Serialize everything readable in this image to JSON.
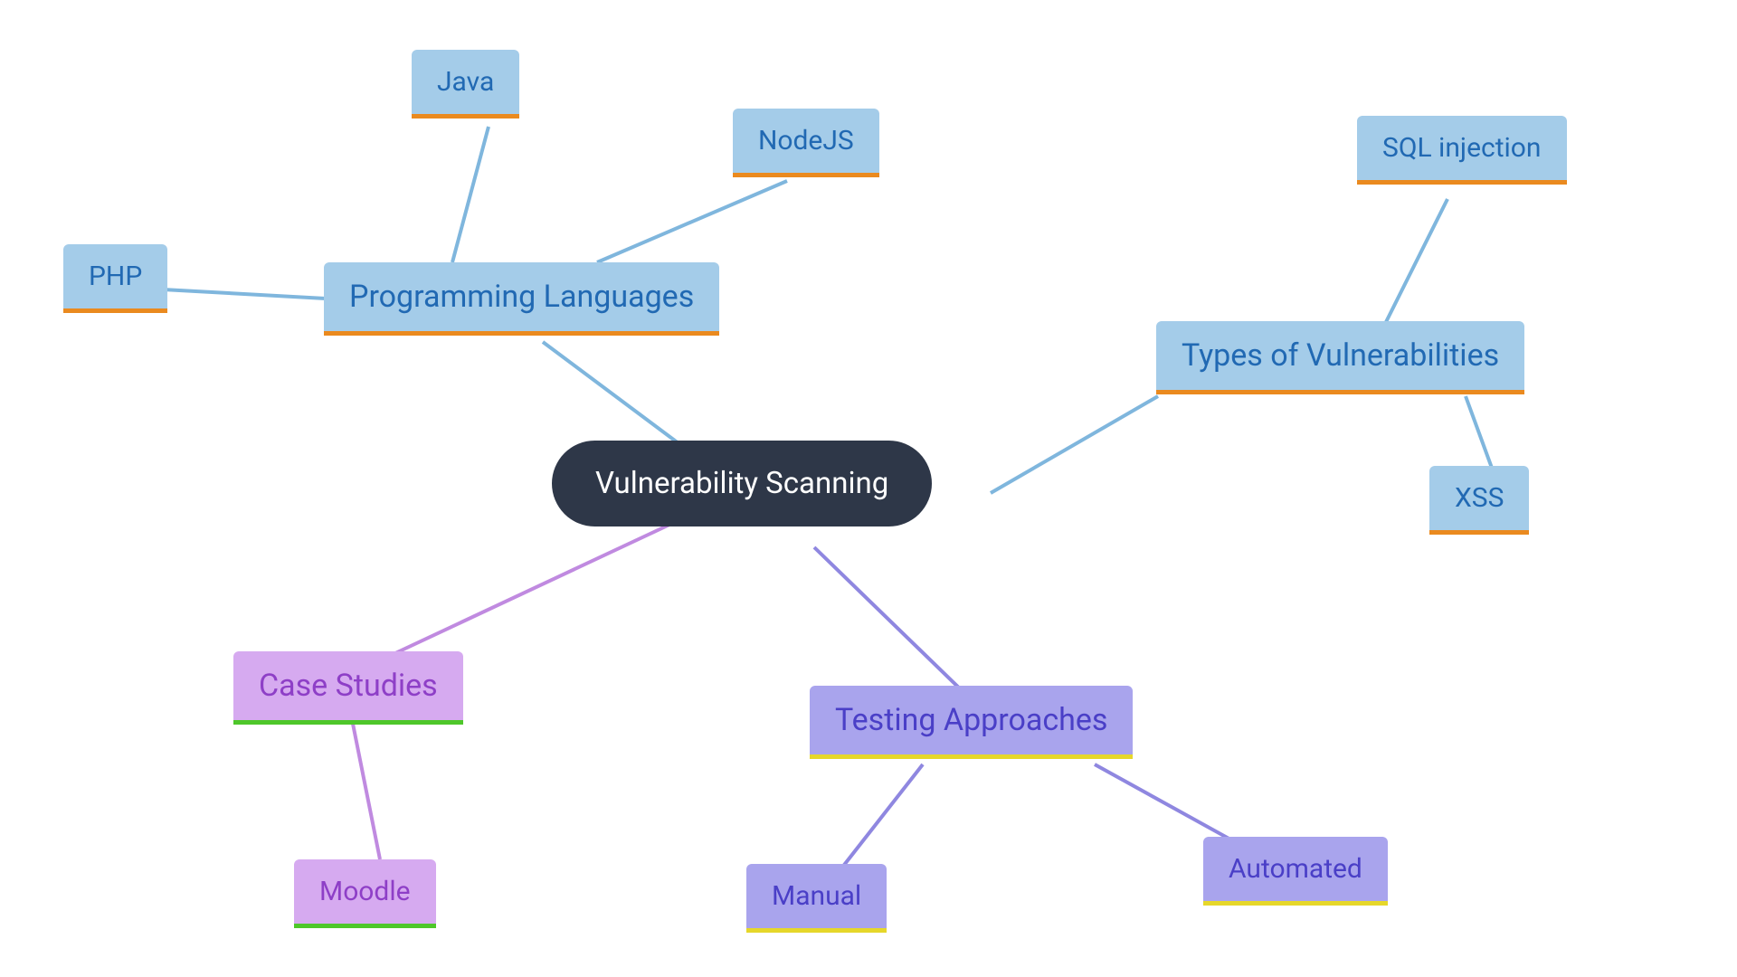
{
  "center": {
    "label": "Vulnerability Scanning"
  },
  "branches": {
    "programming_languages": {
      "label": "Programming Languages",
      "children": {
        "php": "PHP",
        "java": "Java",
        "nodejs": "NodeJS"
      }
    },
    "types": {
      "label": "Types of Vulnerabilities",
      "children": {
        "sql": "SQL injection",
        "xss": "XSS"
      }
    },
    "testing": {
      "label": "Testing Approaches",
      "children": {
        "manual": "Manual",
        "automated": "Automated"
      }
    },
    "cases": {
      "label": "Case Studies",
      "children": {
        "moodle": "Moodle"
      }
    }
  }
}
